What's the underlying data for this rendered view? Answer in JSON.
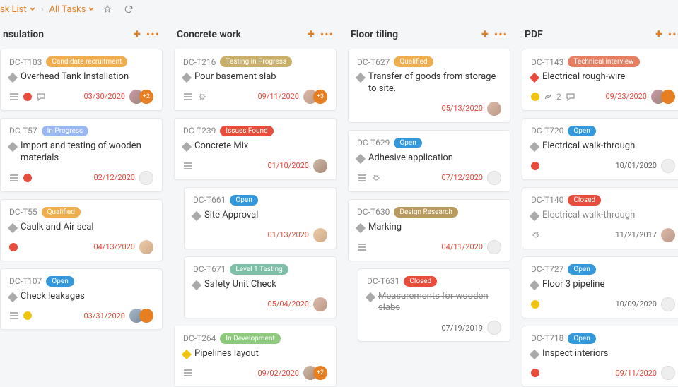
{
  "breadcrumb": {
    "item1": "sk List",
    "item2": "All Tasks"
  },
  "columns": [
    {
      "title": "nsulation",
      "cards": [
        {
          "id": "DC-T103",
          "badge": "Candidate recruitment",
          "badgeColor": "#f0ad4e",
          "title": "Overhead Tank Installation",
          "date": "03/30/2020"
        },
        {
          "id": "DC-T57",
          "badge": "In Progress",
          "badgeColor": "#9bb7f0",
          "title": "Import and testing of wooden materials",
          "date": "02/12/2020"
        },
        {
          "id": "DC-T55",
          "badge": "Qualified",
          "badgeColor": "#f0ad4e",
          "title": "Caulk and Air seal",
          "date": "04/13/2020"
        },
        {
          "id": "DC-T107",
          "badge": "Open",
          "badgeColor": "#3498db",
          "title": "Check leakages",
          "date": "03/31/2020"
        }
      ]
    },
    {
      "title": "Concrete work",
      "cards": [
        {
          "id": "DC-T216",
          "badge": "Testing in Progress",
          "badgeColor": "#c9b06a",
          "title": "Pour basement slab",
          "date": "09/11/2020"
        },
        {
          "id": "DC-T239",
          "badge": "Issues Found",
          "badgeColor": "#e74c3c",
          "title": "Concrete Mix",
          "date": "01/10/2020"
        },
        {
          "id": "DC-T661",
          "badge": "Open",
          "badgeColor": "#3498db",
          "title": "Site Approval",
          "date": "01/13/2020",
          "indent": true
        },
        {
          "id": "DC-T671",
          "badge": "Level 1 Testing",
          "badgeColor": "#7fbfa8",
          "title": "Safety Unit Check",
          "date": "05/04/2020",
          "indent": true
        },
        {
          "id": "DC-T264",
          "badge": "In Development",
          "badgeColor": "#8fc97e",
          "title": "Pipelines layout",
          "date": "09/02/2020"
        }
      ]
    },
    {
      "title": "Floor tiling",
      "cards": [
        {
          "id": "DC-T627",
          "badge": "Qualified",
          "badgeColor": "#f0ad4e",
          "title": "Transfer of goods from storage to site.",
          "date": "05/13/2020"
        },
        {
          "id": "DC-T629",
          "badge": "Open",
          "badgeColor": "#3498db",
          "title": "Adhesive application",
          "date": "07/12/2020"
        },
        {
          "id": "DC-T630",
          "badge": "Design Research",
          "badgeColor": "#b89a5e",
          "title": "Marking",
          "date": "04/11/2020"
        },
        {
          "id": "DC-T631",
          "badge": "Closed",
          "badgeColor": "#e74c3c",
          "title": "Measurements for wooden slabs",
          "date": "07/19/2019",
          "indent": true,
          "strike": true
        }
      ]
    },
    {
      "title": "PDF",
      "cards": [
        {
          "id": "DC-T143",
          "badge": "Technical interview",
          "badgeColor": "#e67e62",
          "title": "Electrical rough-wire",
          "date": "09/23/2020",
          "count": "2"
        },
        {
          "id": "DC-T720",
          "badge": "Open",
          "badgeColor": "#3498db",
          "title": "Electrical walk-through",
          "date": "10/01/2020"
        },
        {
          "id": "DC-T140",
          "badge": "Closed",
          "badgeColor": "#e74c3c",
          "title": "Electrical walk-through",
          "date": "11/21/2017",
          "strike": true
        },
        {
          "id": "DC-T727",
          "badge": "Open",
          "badgeColor": "#3498db",
          "title": "Floor 3 pipeline",
          "date": "10/09/2020"
        },
        {
          "id": "DC-T718",
          "badge": "Open",
          "badgeColor": "#3498db",
          "title": "Inspect interiors",
          "date": "09/11/2020"
        }
      ]
    }
  ]
}
